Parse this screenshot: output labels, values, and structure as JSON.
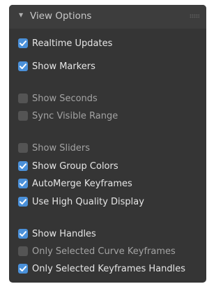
{
  "panel": {
    "title": "View Options",
    "collapse_icon": "triangle-down-icon",
    "grip_icon": "drag-grip-icon"
  },
  "colors": {
    "checked": "#4a90d9",
    "unchecked": "#545454",
    "panel_bg": "#353535",
    "header_bg": "#3d3d3d"
  },
  "options": [
    {
      "id": "realtime-updates",
      "label": "Realtime Updates",
      "checked": true
    },
    {
      "id": "show-markers",
      "label": "Show Markers",
      "checked": true
    },
    {
      "id": "show-seconds",
      "label": "Show Seconds",
      "checked": false
    },
    {
      "id": "sync-visible-range",
      "label": "Sync Visible Range",
      "checked": false
    },
    {
      "id": "show-sliders",
      "label": "Show Sliders",
      "checked": false
    },
    {
      "id": "show-group-colors",
      "label": "Show Group Colors",
      "checked": true
    },
    {
      "id": "automerge-keyframes",
      "label": "AutoMerge Keyframes",
      "checked": true
    },
    {
      "id": "use-high-quality-display",
      "label": "Use High Quality Display",
      "checked": true
    },
    {
      "id": "show-handles",
      "label": "Show Handles",
      "checked": true
    },
    {
      "id": "only-selected-curve-keyframes",
      "label": "Only Selected Curve Keyframes",
      "checked": false
    },
    {
      "id": "only-selected-keyframes-handles",
      "label": "Only Selected Keyframes Handles",
      "checked": true
    }
  ]
}
